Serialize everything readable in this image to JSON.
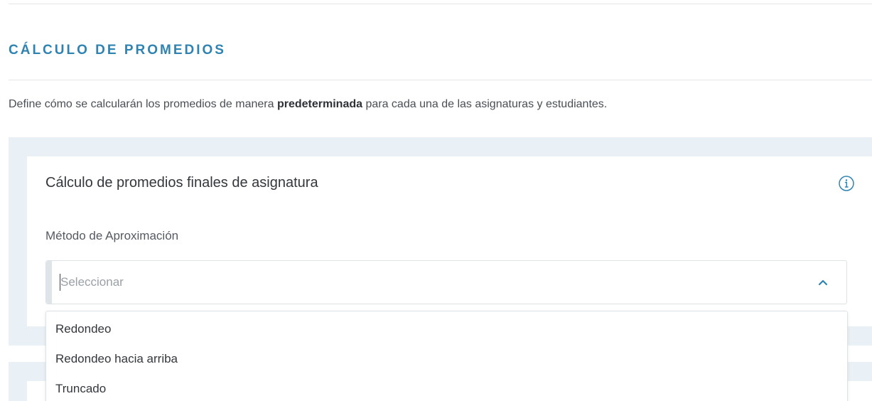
{
  "section": {
    "title": "CÁLCULO DE PROMEDIOS",
    "description_before": "Define cómo se calcularán los promedios de manera ",
    "description_bold": "predeterminada",
    "description_after": " para cada una de las asignaturas y estudiantes."
  },
  "card": {
    "title": "Cálculo de promedios finales de asignatura",
    "info_icon": "info-circle-icon"
  },
  "field": {
    "label": "Método de Aproximación",
    "placeholder": "Seleccionar",
    "value": "",
    "chevron_icon": "chevron-up-icon"
  },
  "dropdown": {
    "options": [
      "Redondeo",
      "Redondeo hacia arriba",
      "Truncado"
    ]
  },
  "colors": {
    "accent": "#2f83b1",
    "panel_bg": "#eaf1f6",
    "border": "#dde2e6"
  }
}
